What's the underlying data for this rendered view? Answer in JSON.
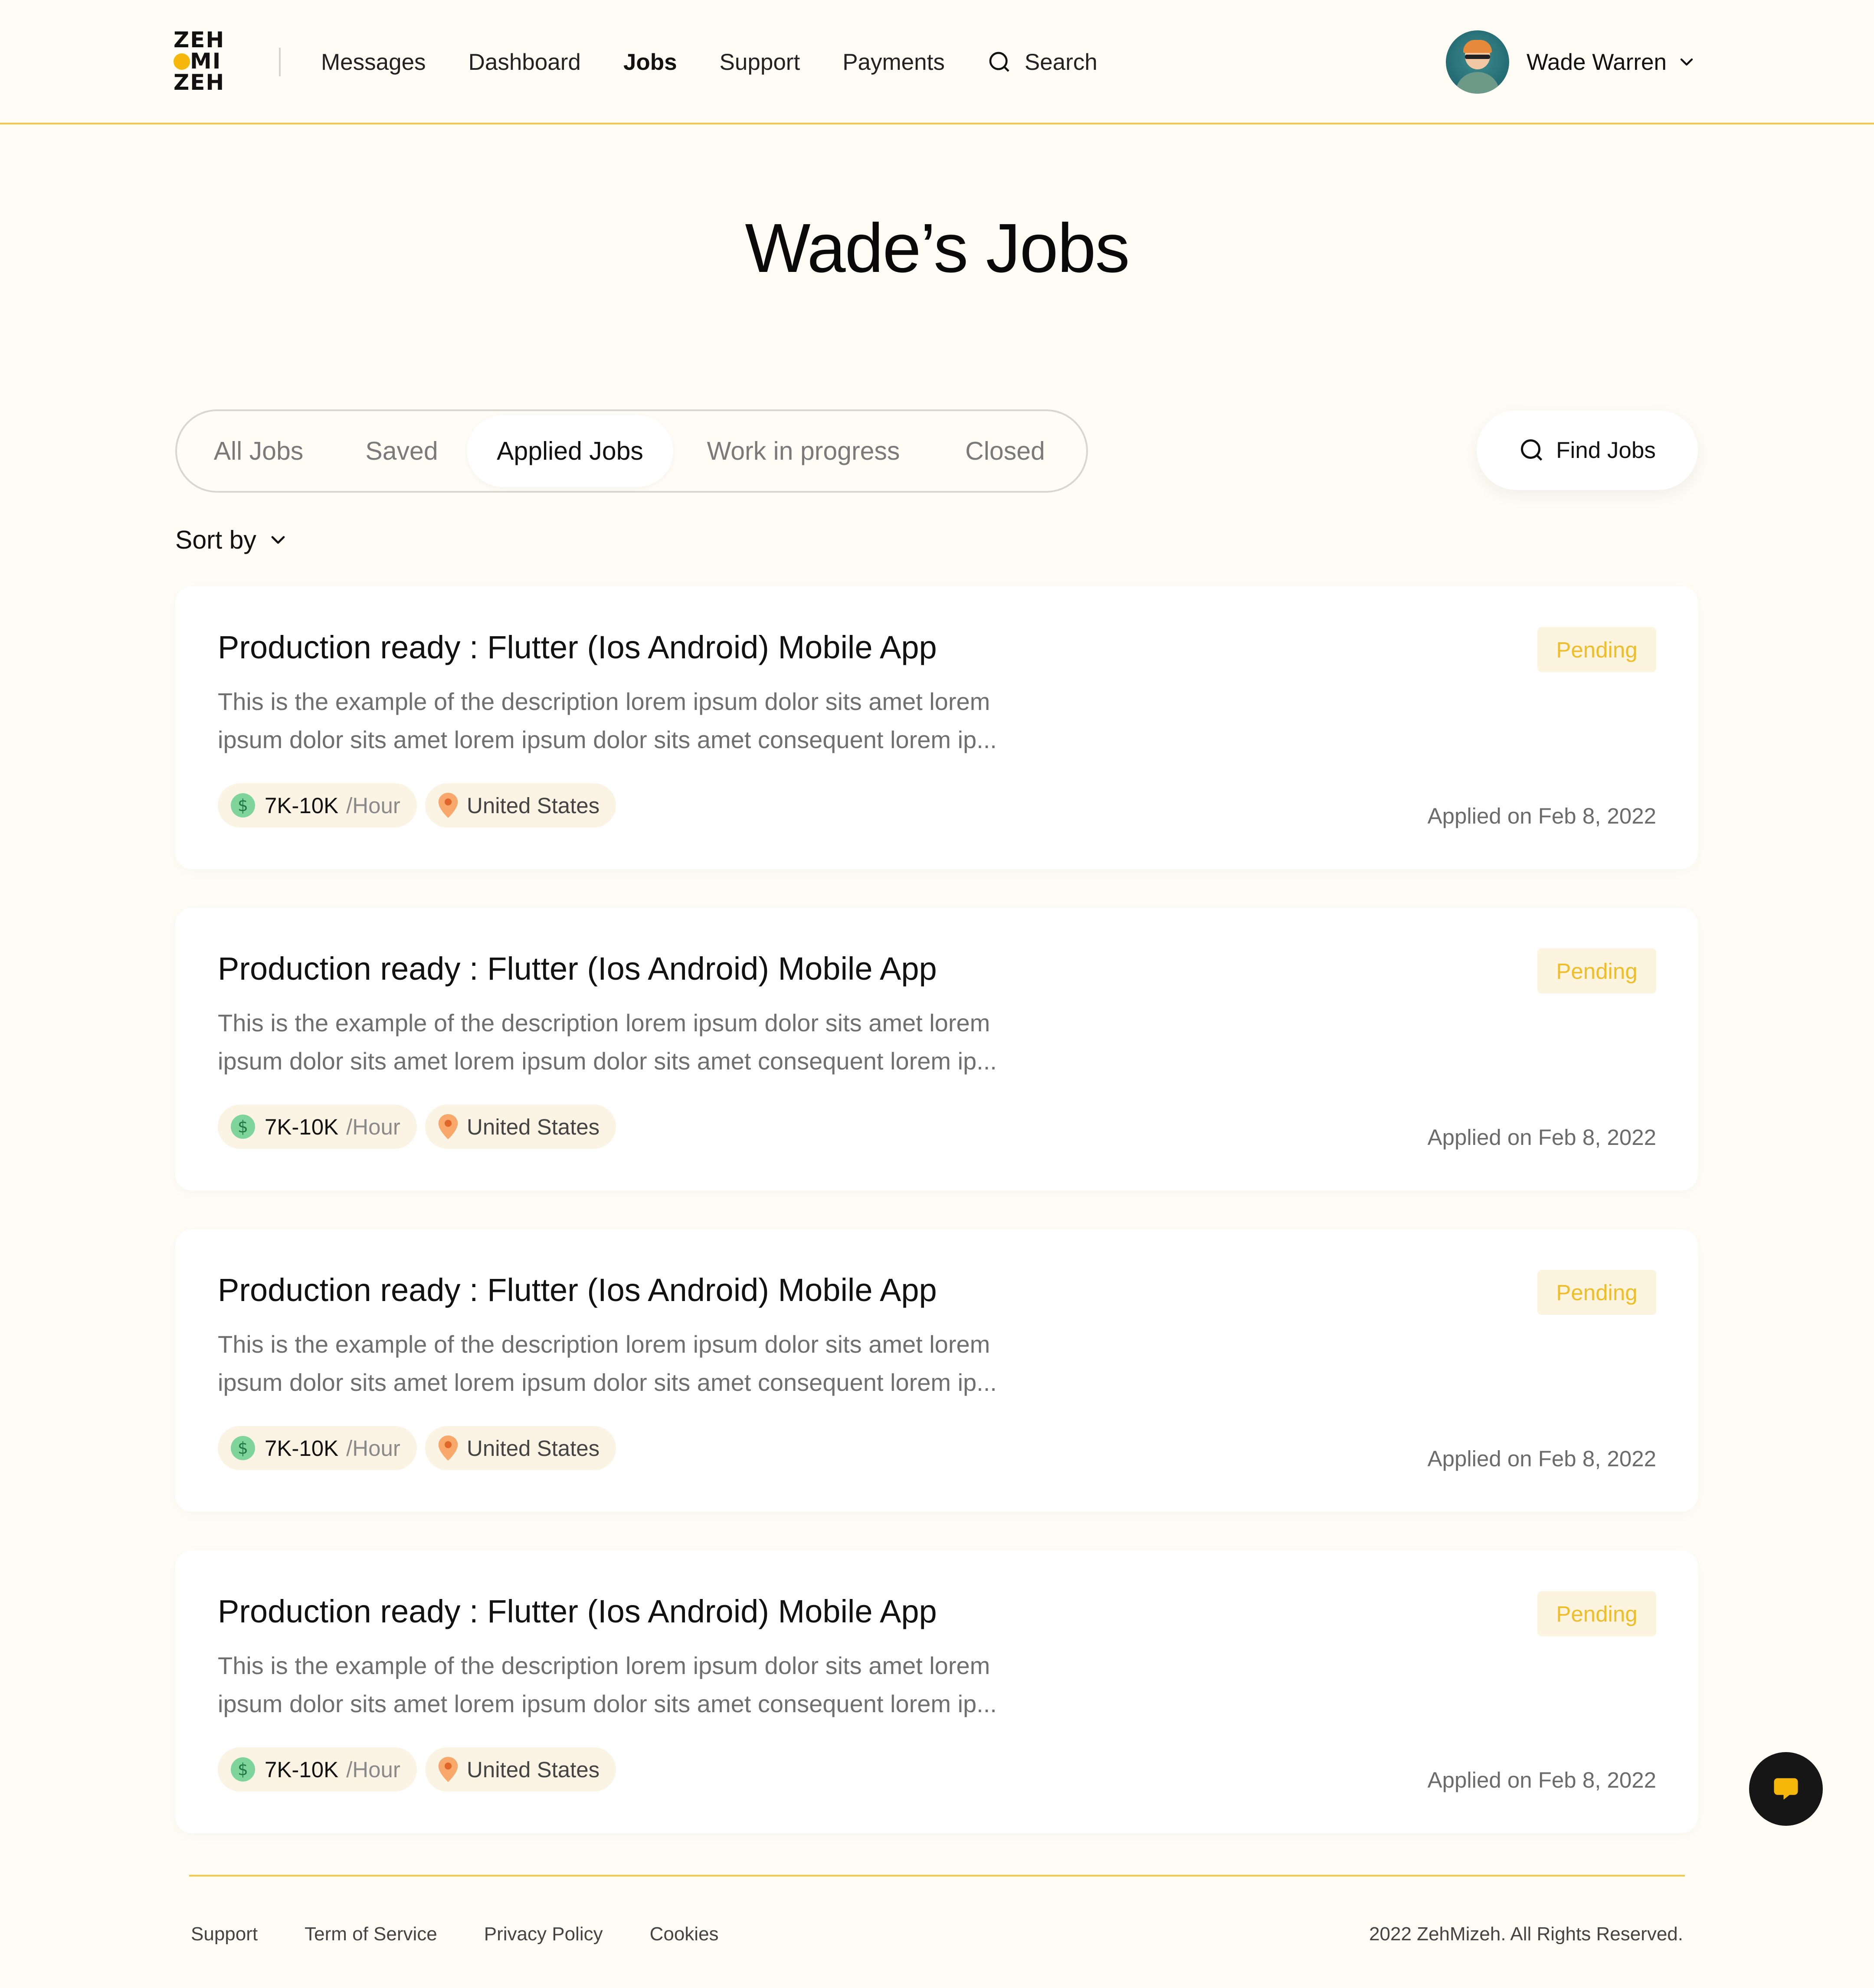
{
  "header": {
    "logo": {
      "line1": "ZEH",
      "line2": "MI",
      "line3": "ZEH"
    },
    "nav": [
      {
        "label": "Messages"
      },
      {
        "label": "Dashboard"
      },
      {
        "label": "Jobs",
        "active": true
      },
      {
        "label": "Support"
      },
      {
        "label": "Payments"
      }
    ],
    "search_label": "Search",
    "user": {
      "name": "Wade Warren"
    }
  },
  "page": {
    "title": "Wade’s Jobs"
  },
  "tabs": [
    {
      "label": "All Jobs"
    },
    {
      "label": "Saved"
    },
    {
      "label": "Applied Jobs",
      "active": true
    },
    {
      "label": "Work in progress"
    },
    {
      "label": "Closed"
    }
  ],
  "find_jobs_label": "Find Jobs",
  "sort_label": "Sort by",
  "jobs": [
    {
      "title": "Production ready : Flutter (Ios Android) Mobile App",
      "description": "This is the example of the description lorem ipsum dolor sits amet lorem ipsum dolor sits amet lorem ipsum dolor sits amet consequent lorem ip...",
      "rate": "7K-10K",
      "rate_unit": "/Hour",
      "location": "United States",
      "status": "Pending",
      "applied": "Applied on Feb 8, 2022"
    },
    {
      "title": "Production ready : Flutter (Ios Android) Mobile App",
      "description": "This is the example of the description lorem ipsum dolor sits amet lorem ipsum dolor sits amet lorem ipsum dolor sits amet consequent lorem ip...",
      "rate": "7K-10K",
      "rate_unit": "/Hour",
      "location": "United States",
      "status": "Pending",
      "applied": "Applied on Feb 8, 2022"
    },
    {
      "title": "Production ready : Flutter (Ios Android) Mobile App",
      "description": "This is the example of the description lorem ipsum dolor sits amet lorem ipsum dolor sits amet lorem ipsum dolor sits amet consequent lorem ip...",
      "rate": "7K-10K",
      "rate_unit": "/Hour",
      "location": "United States",
      "status": "Pending",
      "applied": "Applied on Feb 8, 2022"
    },
    {
      "title": "Production ready : Flutter (Ios Android) Mobile App",
      "description": "This is the example of the description lorem ipsum dolor sits amet lorem ipsum dolor sits amet lorem ipsum dolor sits amet consequent lorem ip...",
      "rate": "7K-10K",
      "rate_unit": "/Hour",
      "location": "United States",
      "status": "Pending",
      "applied": "Applied on Feb 8, 2022"
    }
  ],
  "footer": {
    "links": [
      {
        "label": "Support"
      },
      {
        "label": "Term of Service"
      },
      {
        "label": "Privacy Policy"
      },
      {
        "label": "Cookies"
      }
    ],
    "copyright": "2022 ZehMizeh. All Rights Reserved."
  },
  "colors": {
    "background": "#fffcf5",
    "accent": "#f2c94c",
    "pending_text": "#f0bd2a",
    "pending_bg": "#fdf4e0",
    "chat_button": "#161616"
  },
  "icons": {
    "search": "search-icon",
    "chevron": "chevron-down-icon",
    "rate": "dollar-icon",
    "location": "location-pin-icon",
    "chat": "chat-bubble-icon"
  }
}
